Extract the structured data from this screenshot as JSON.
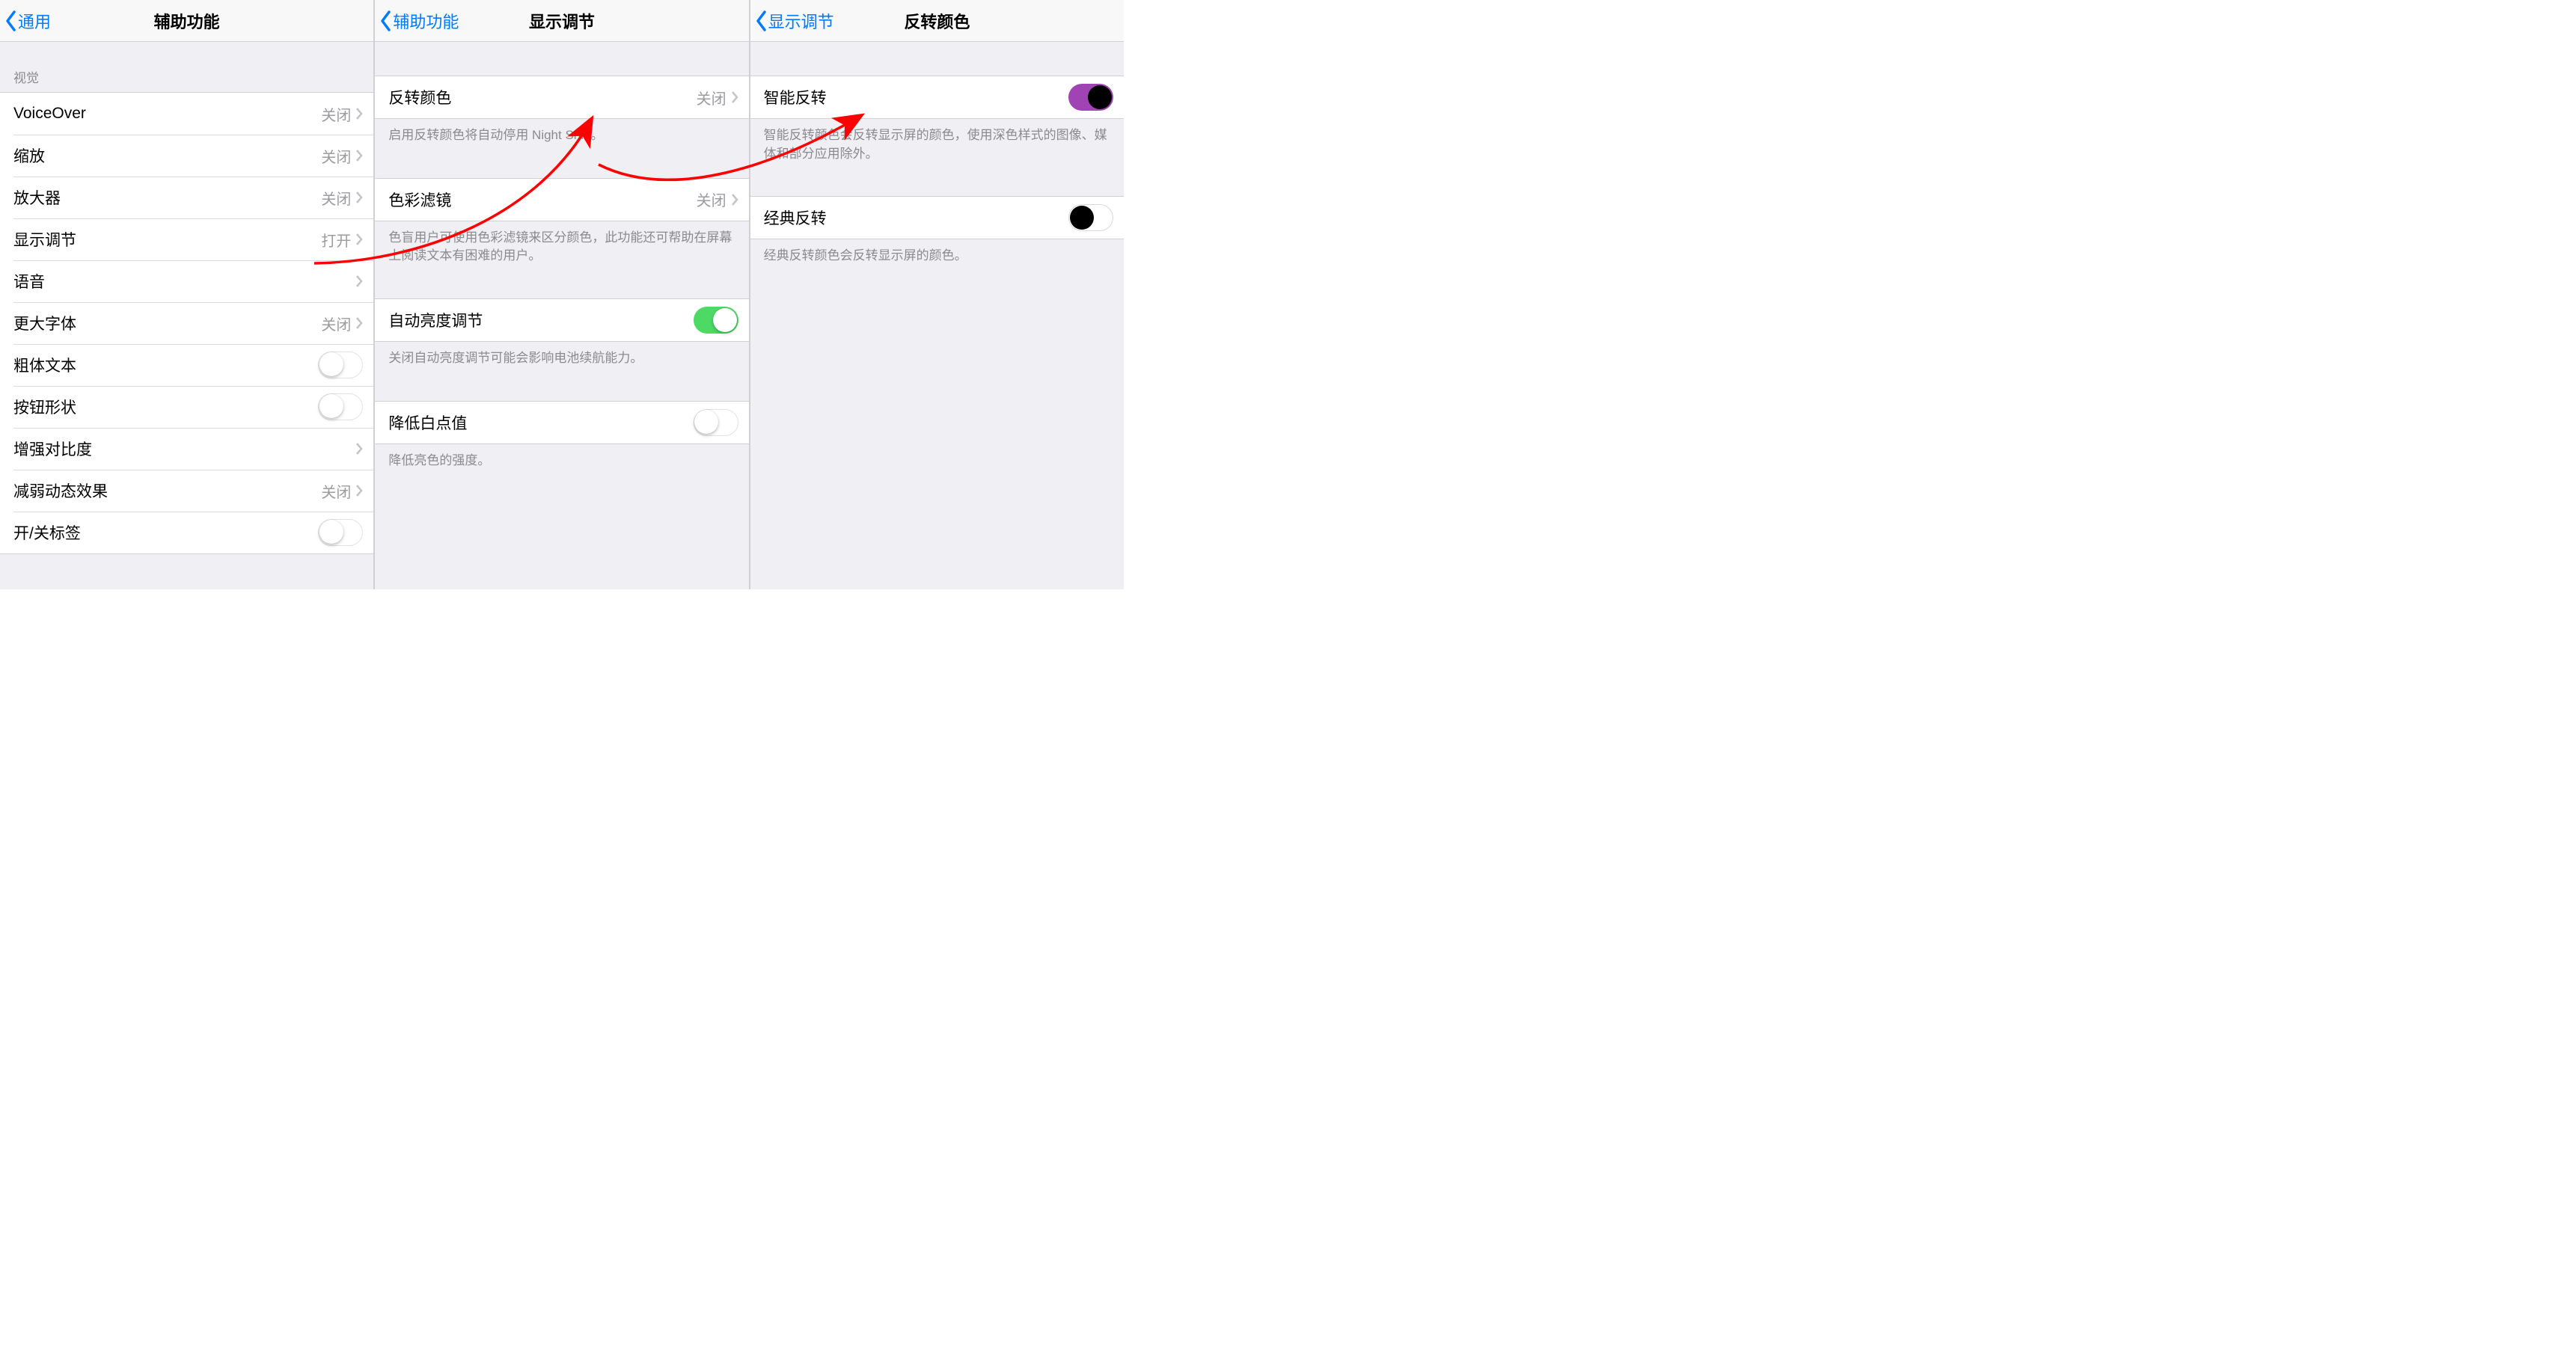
{
  "panel1": {
    "back": "通用",
    "title": "辅助功能",
    "section_vision": "视觉",
    "items": [
      {
        "label": "VoiceOver",
        "value": "关闭"
      },
      {
        "label": "缩放",
        "value": "关闭"
      },
      {
        "label": "放大器",
        "value": "关闭"
      },
      {
        "label": "显示调节",
        "value": "打开"
      },
      {
        "label": "语音",
        "value": ""
      },
      {
        "label": "更大字体",
        "value": "关闭"
      },
      {
        "label": "粗体文本"
      },
      {
        "label": "按钮形状"
      },
      {
        "label": "增强对比度",
        "value": ""
      },
      {
        "label": "减弱动态效果",
        "value": "关闭"
      },
      {
        "label": "开/关标签"
      }
    ]
  },
  "panel2": {
    "back": "辅助功能",
    "title": "显示调节",
    "invert": {
      "label": "反转颜色",
      "value": "关闭"
    },
    "invert_footer": "启用反转颜色将自动停用 Night Shift。",
    "filter": {
      "label": "色彩滤镜",
      "value": "关闭"
    },
    "filter_footer": "色盲用户可使用色彩滤镜来区分颜色，此功能还可帮助在屏幕上阅读文本有困难的用户。",
    "auto_bright": {
      "label": "自动亮度调节"
    },
    "auto_bright_footer": "关闭自动亮度调节可能会影响电池续航能力。",
    "whitepoint": {
      "label": "降低白点值"
    },
    "whitepoint_footer": "降低亮色的强度。"
  },
  "panel3": {
    "back": "显示调节",
    "title": "反转颜色",
    "smart": {
      "label": "智能反转"
    },
    "smart_footer": "智能反转颜色会反转显示屏的颜色，使用深色样式的图像、媒体和部分应用除外。",
    "classic": {
      "label": "经典反转"
    },
    "classic_footer": "经典反转颜色会反转显示屏的颜色。"
  }
}
